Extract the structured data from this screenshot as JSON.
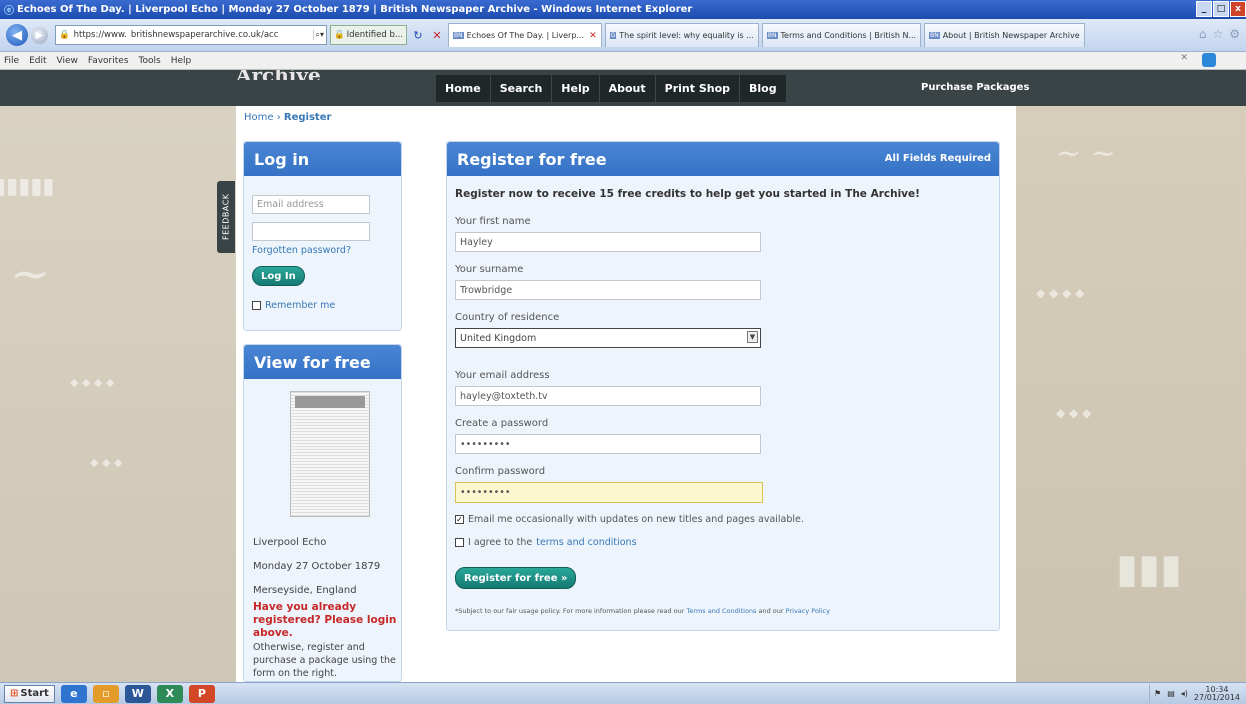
{
  "window": {
    "title": "Echoes Of The Day. | Liverpool Echo | Monday 27 October 1879 | British Newspaper Archive - Windows Internet Explorer",
    "buttons": [
      "_",
      "□",
      "x"
    ]
  },
  "browser": {
    "address_prefix": "https://www.",
    "address_domain": "britishnewspaperarchive.co.uk/acc",
    "identified_label": "Identified b...",
    "tabs": [
      {
        "label": "Echoes Of The Day. | Liverp...",
        "active": true
      },
      {
        "label": "The spirit level: why equality is ...",
        "active": false
      },
      {
        "label": "Terms and Conditions | British N...",
        "active": false
      },
      {
        "label": "About | British Newspaper Archive",
        "active": false
      }
    ]
  },
  "menubar": {
    "items": [
      "File",
      "Edit",
      "View",
      "Favorites",
      "Tools",
      "Help"
    ]
  },
  "site": {
    "logo_text": "Archive",
    "nav": [
      "Home",
      "Search",
      "Help",
      "About",
      "Print Shop",
      "Blog"
    ],
    "purchase_label": "Purchase Packages",
    "breadcrumb": {
      "home": "Home",
      "sep": "›",
      "current": "Register"
    },
    "feedback_tab": "FEEDBACK"
  },
  "login": {
    "title": "Log in",
    "email_placeholder": "Email address",
    "forgotten": "Forgotten password?",
    "button": "Log In",
    "remember": "Remember me"
  },
  "view": {
    "title": "View for free",
    "paper": "Liverpool Echo",
    "date": "Monday 27 October 1879",
    "place": "Merseyside, England",
    "red_note": "Have you already registered? Please login above.",
    "note": "Otherwise, register and purchase a package using the form on the right."
  },
  "register": {
    "title": "Register for free",
    "required": "All Fields Required",
    "intro": "Register now to receive 15 free credits to help get you started in The Archive!",
    "first_name_label": "Your first name",
    "first_name": "Hayley",
    "surname_label": "Your surname",
    "surname": "Trowbridge",
    "country_label": "Country of residence",
    "country": "United Kingdom",
    "email_label": "Your email address",
    "email": "hayley@toxteth.tv",
    "password_label": "Create a password",
    "password": "•••••••••",
    "confirm_label": "Confirm password",
    "confirm": "•••••••••",
    "email_opt": "Email me occasionally with updates on new titles and pages available.",
    "email_opt_checked": true,
    "agree_prefix": "I agree to the",
    "agree_link": "terms and conditions",
    "button": "Register for free »",
    "fine_prefix": "*Subject to our fair usage policy. For more information please read our",
    "fine_terms": "Terms and Conditions",
    "fine_and": "and our",
    "fine_privacy": "Privacy Policy"
  },
  "taskbar": {
    "start": "Start",
    "time": "10:34",
    "date": "27/01/2014"
  },
  "colors": {
    "header": "#3a4446",
    "panel_blue": "#3a78c9",
    "button_green": "#1e8f86",
    "error_red": "#c62828"
  }
}
